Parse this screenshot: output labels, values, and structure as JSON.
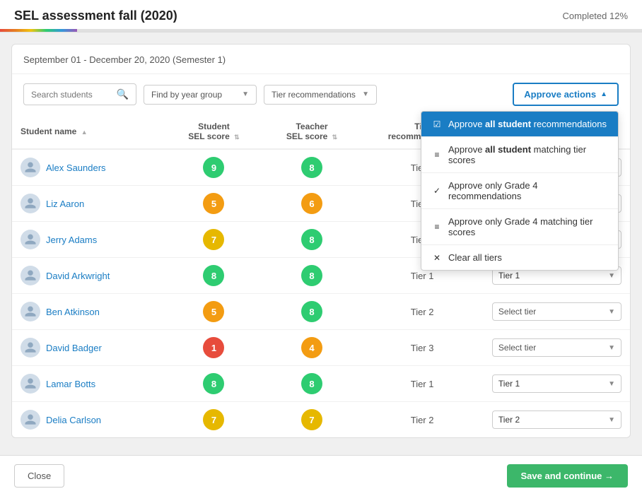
{
  "topBar": {
    "title": "SEL assessment fall (2020)",
    "progressText": "Completed 12%",
    "progressPercent": 12
  },
  "dateRange": "September 01 - December 20, 2020 (Semester 1)",
  "search": {
    "placeholder": "Search students"
  },
  "filters": {
    "yearGroup": {
      "label": "Find by year group",
      "placeholder": "Find by year group"
    },
    "tierRec": {
      "label": "Tier recommendations",
      "placeholder": "Tier recommendations"
    }
  },
  "approveButton": {
    "label": "Approve actions"
  },
  "approveMenu": {
    "items": [
      {
        "id": "approve-all-rec",
        "icon": "☑",
        "text_prefix": "Approve ",
        "text_bold": "all student",
        "text_suffix": " recommendations",
        "active": true
      },
      {
        "id": "approve-all-scores",
        "icon": "≡",
        "text_prefix": "Approve ",
        "text_bold": "all student",
        "text_suffix": " matching tier scores"
      },
      {
        "id": "approve-grade4-rec",
        "icon": "✓",
        "text_prefix": "Approve only Grade 4 recommendations"
      },
      {
        "id": "approve-grade4-scores",
        "icon": "≡",
        "text_prefix": "Approve only Grade 4 matching tier scores"
      },
      {
        "id": "clear-tiers",
        "icon": "✕",
        "text_prefix": "Clear all tiers"
      }
    ]
  },
  "table": {
    "columns": [
      {
        "id": "name",
        "label": "Student name",
        "sortable": true
      },
      {
        "id": "student-sel",
        "label": "Student SEL score",
        "sortable": true
      },
      {
        "id": "teacher-sel",
        "label": "Teacher SEL score",
        "sortable": true
      },
      {
        "id": "tier-rec",
        "label": "Tier recommendation",
        "sortable": false
      },
      {
        "id": "tier-select",
        "label": "",
        "sortable": false
      }
    ],
    "rows": [
      {
        "name": "Alex Saunders",
        "studentScore": 9,
        "studentColor": "green",
        "teacherScore": 8,
        "teacherColor": "green",
        "tierRec": "Tier 1",
        "tierSelected": ""
      },
      {
        "name": "Liz Aaron",
        "studentScore": 5,
        "studentColor": "orange",
        "teacherScore": 6,
        "teacherColor": "orange",
        "tierRec": "Tier 2",
        "tierSelected": ""
      },
      {
        "name": "Jerry Adams",
        "studentScore": 7,
        "studentColor": "yellow",
        "teacherScore": 8,
        "teacherColor": "green",
        "tierRec": "Tier 2",
        "tierSelected": ""
      },
      {
        "name": "David Arkwright",
        "studentScore": 8,
        "studentColor": "green",
        "teacherScore": 8,
        "teacherColor": "green",
        "tierRec": "Tier 1",
        "tierSelected": "Tier 1"
      },
      {
        "name": "Ben Atkinson",
        "studentScore": 5,
        "studentColor": "orange",
        "teacherScore": 8,
        "teacherColor": "green",
        "tierRec": "Tier 2",
        "tierSelected": ""
      },
      {
        "name": "David Badger",
        "studentScore": 1,
        "studentColor": "red",
        "teacherScore": 4,
        "teacherColor": "orange",
        "tierRec": "Tier 3",
        "tierSelected": ""
      },
      {
        "name": "Lamar Botts",
        "studentScore": 8,
        "studentColor": "green",
        "teacherScore": 8,
        "teacherColor": "green",
        "tierRec": "Tier 1",
        "tierSelected": "Tier 1"
      },
      {
        "name": "Delia Carlson",
        "studentScore": 7,
        "studentColor": "yellow",
        "teacherScore": 7,
        "teacherColor": "yellow",
        "tierRec": "Tier 2",
        "tierSelected": "Tier 2"
      }
    ]
  },
  "footer": {
    "closeLabel": "Close",
    "saveLabel": "Save and continue →"
  },
  "selectPlaceholder": "Select tier"
}
